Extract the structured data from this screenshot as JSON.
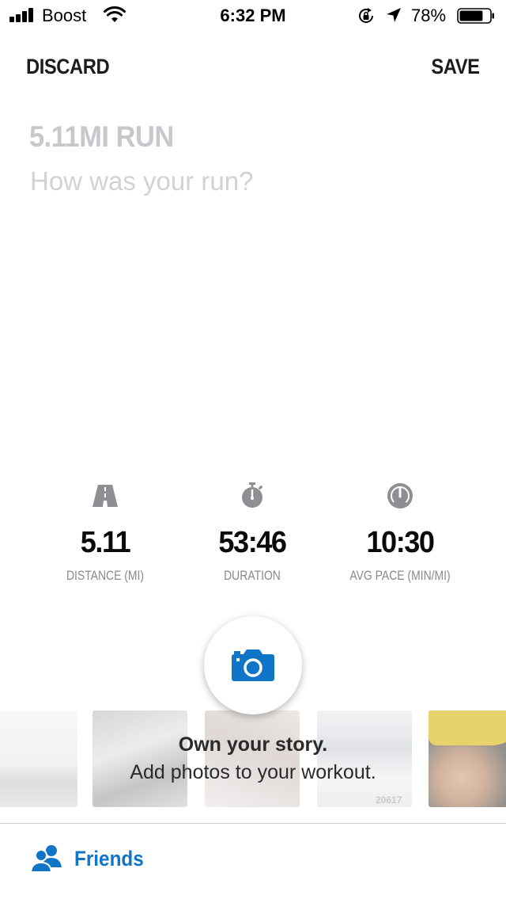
{
  "status_bar": {
    "carrier": "Boost",
    "time": "6:32 PM",
    "battery_percent": "78%",
    "battery_level": 0.78,
    "icons": [
      "signal-icon",
      "wifi-icon",
      "rotation-lock-icon",
      "location-arrow-icon",
      "battery-icon"
    ]
  },
  "nav": {
    "discard_label": "DISCARD",
    "save_label": "SAVE"
  },
  "workout": {
    "title": "5.11MI RUN",
    "description_placeholder": "How was your run?"
  },
  "stats": [
    {
      "icon": "road-icon",
      "value": "5.11",
      "label": "DISTANCE (MI)"
    },
    {
      "icon": "stopwatch-icon",
      "value": "53:46",
      "label": "DURATION"
    },
    {
      "icon": "speedometer-icon",
      "value": "10:30",
      "label": "AVG PACE (MIN/MI)"
    }
  ],
  "photos": {
    "camera_icon": "camera-icon",
    "title": "Own your story.",
    "subtitle": "Add photos to your workout.",
    "thumbnail_text": "20617"
  },
  "audience": {
    "icon": "friends-icon",
    "label": "Friends"
  },
  "colors": {
    "accent": "#1175c7",
    "placeholder": "#c8c8cc",
    "stat_label": "#8a8a8a",
    "icon_gray": "#8e8e93"
  }
}
